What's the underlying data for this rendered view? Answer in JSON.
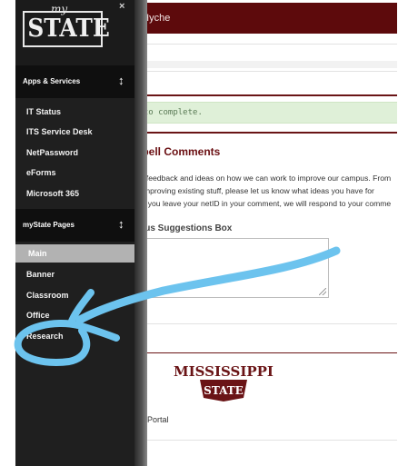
{
  "header": {
    "user_text": "e Hyche"
  },
  "notice": {
    "text": "s to complete."
  },
  "comments": {
    "heading": "wbell Comments",
    "lines": [
      "our feedback and ideas on how we can work to improve our campus. From",
      "or improving existing stuff, please let us know what ideas you have for",
      "e! If you leave your netID in your comment, we will respond to your comme"
    ],
    "box_label": "nous Suggestions Box"
  },
  "footer": {
    "logo_top": "MISSISSIPPI",
    "logo_bottom": "STATE",
    "link_text": "tics Portal"
  },
  "sidebar": {
    "logo_small": "my",
    "logo_main": "STATE",
    "close_glyph": "×",
    "apps_section": {
      "label": "Apps & Services",
      "arrow": "↕"
    },
    "apps_items": [
      "IT Status",
      "ITS Service Desk",
      "NetPassword",
      "eForms",
      "Microsoft 365"
    ],
    "pages_section": {
      "label": "myState Pages",
      "arrow": "↕"
    },
    "pages_items": [
      "Main",
      "Banner",
      "Classroom",
      "Office",
      "Research"
    ]
  },
  "colors": {
    "maroon": "#5d0a0c",
    "sidebar": "#1f1f1f",
    "annotation": "#6cc3ee"
  },
  "annotation": {
    "kind": "hand-drawn arrow circling the Research menu item",
    "icon": "arrow-annotation"
  }
}
